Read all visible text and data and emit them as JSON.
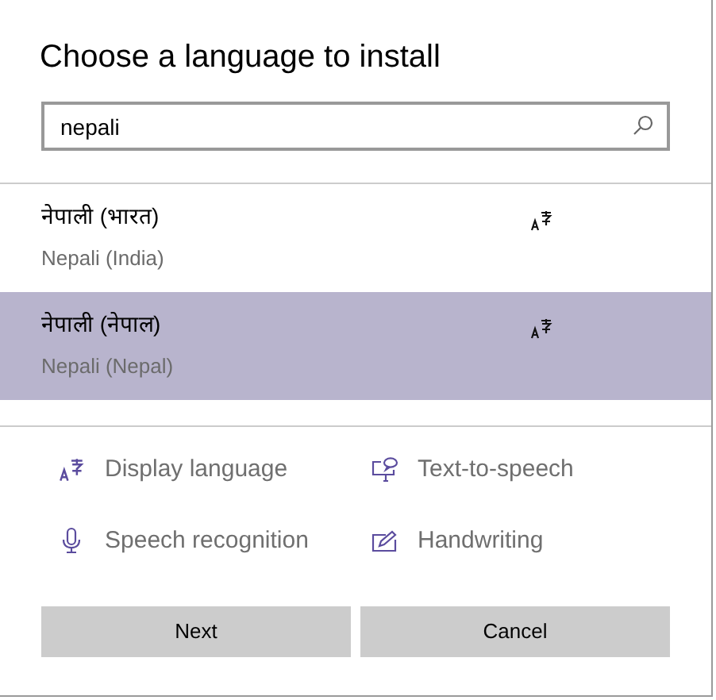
{
  "dialog": {
    "title": "Choose a language to install"
  },
  "search": {
    "value": "nepali"
  },
  "languages": [
    {
      "native": "नेपाली (भारत)",
      "english": "Nepali (India)",
      "selected": false
    },
    {
      "native": "नेपाली (नेपाल)",
      "english": "Nepali (Nepal)",
      "selected": true
    }
  ],
  "features": [
    {
      "kind": "display",
      "label": "Display language"
    },
    {
      "kind": "tts",
      "label": "Text-to-speech"
    },
    {
      "kind": "speech",
      "label": "Speech recognition"
    },
    {
      "kind": "handwriting",
      "label": "Handwriting"
    }
  ],
  "buttons": [
    "Next",
    "Cancel"
  ]
}
